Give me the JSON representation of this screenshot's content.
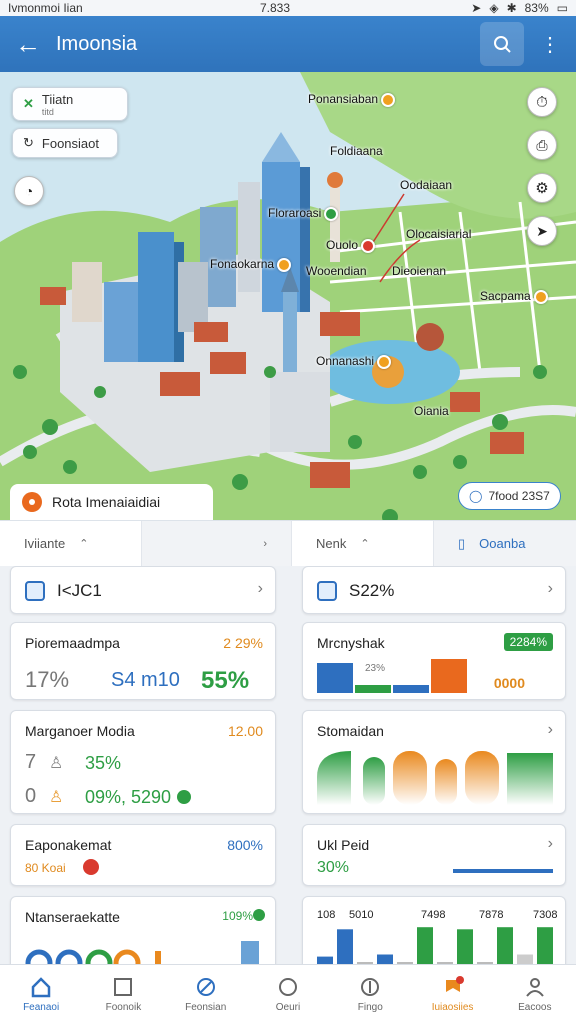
{
  "status": {
    "left": "Ivmonmoi Iian",
    "time": "7.833",
    "battery": "83%"
  },
  "appbar": {
    "title": "Imoonsia"
  },
  "map": {
    "chip1": {
      "title": "Tiiatn",
      "sub": "titd"
    },
    "chip2": {
      "title": "Foonsiaot"
    },
    "labels": {
      "a": "Ponansiaban",
      "b": "Foldiaana",
      "c": "Oodaiaan",
      "d": "Floraroasi",
      "e": "Ouolo",
      "f": "Olocaisiarial",
      "g": "Fonaokarna",
      "h": "Wooendian",
      "i": "Dieoienan",
      "j": "Sacpama",
      "k": "Onnanashi",
      "l": "Oiania"
    },
    "timechip": "7food 23S7"
  },
  "sheet": {
    "title": "Rota Imenaiaidiai"
  },
  "tabs": [
    {
      "label": "Iviiante"
    },
    {
      "label": "Nenk"
    },
    {
      "label": "Ooanba"
    }
  ],
  "cards": {
    "c1": {
      "value": "I<JC1"
    },
    "c2": {
      "value": "S22%"
    },
    "c3": {
      "title": "Pioremaadmpa",
      "tag": "2 29%",
      "v1": "17%",
      "v2": "S4 m10",
      "v3": "55%"
    },
    "c4": {
      "title": "Mrcnyshak",
      "badge": "2284%",
      "sub1": "23%",
      "sub2": "0000"
    },
    "c5": {
      "title": "Marganoer Modia",
      "tag": "12.00",
      "r1a": "7",
      "r1b": "35%",
      "r2a": "0",
      "r2b": "09%, 5290"
    },
    "c6": {
      "title": "Stomaidan"
    },
    "c7": {
      "title": "Eaponakemat",
      "tag": "800%",
      "sub": "80 Koai"
    },
    "c8": {
      "title": "Ukl Peid",
      "value": "30%"
    },
    "c9": {
      "title": "Ntanseraekatte",
      "tag": "109%"
    },
    "c10": {
      "labels": [
        "108",
        "5010",
        "7498",
        "7878",
        "7308"
      ]
    }
  },
  "chart_data": [
    {
      "type": "bar",
      "categories": [
        "1",
        "2",
        "3",
        "4"
      ],
      "series": [
        {
          "values": [
            0.75,
            0.2,
            0.2,
            0.85
          ]
        }
      ],
      "colors": [
        "#2e6fbf",
        "#2e9e44",
        "#2e6fbf",
        "#e9691e"
      ],
      "ylim": [
        0,
        1
      ]
    },
    {
      "type": "bar",
      "categories": [
        "1",
        "2",
        "3",
        "4",
        "5",
        "6",
        "7",
        "8",
        "9",
        "10",
        "11",
        "12"
      ],
      "series": [
        {
          "values": [
            0.2,
            0.85,
            0.05,
            0.25,
            0.05,
            0.9,
            0.05,
            0.85,
            0.05,
            0.9,
            0.25,
            0.9
          ]
        }
      ],
      "colors": [
        "#2e6fbf",
        "#2e6fbf",
        "#bbb",
        "#2e6fbf",
        "#bbb",
        "#2e9e44",
        "#bbb",
        "#2e9e44",
        "#bbb",
        "#2e9e44",
        "#ccc",
        "#2e9e44"
      ],
      "ylim": [
        0,
        1
      ]
    }
  ],
  "nav": [
    {
      "label": "Feanaoi",
      "icon": "home-icon"
    },
    {
      "label": "Foonoik",
      "icon": "chart-icon"
    },
    {
      "label": "Feonsian",
      "icon": "compass-icon"
    },
    {
      "label": "Oeuri",
      "icon": "search-icon"
    },
    {
      "label": "Fingo",
      "icon": "pin-icon"
    },
    {
      "label": "Iuiaosiies",
      "icon": "flag-icon"
    },
    {
      "label": "Eacoos",
      "icon": "user-icon"
    }
  ]
}
